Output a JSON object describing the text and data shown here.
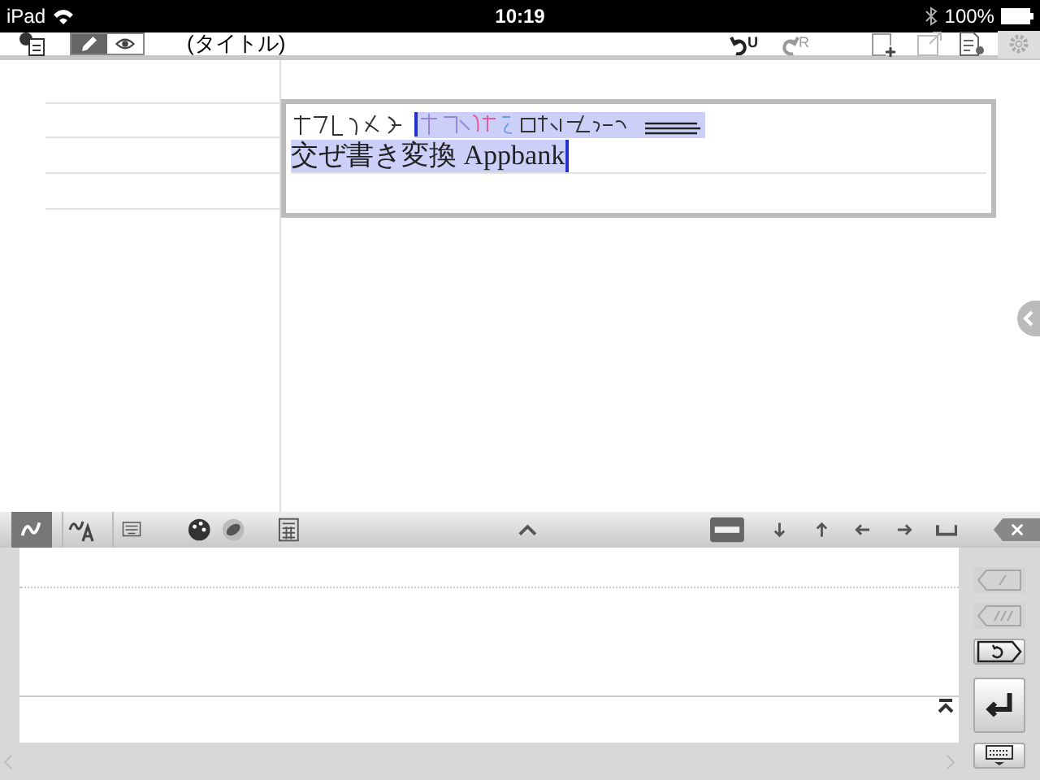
{
  "status_bar": {
    "device": "iPad",
    "time": "10:19",
    "battery": "100%"
  },
  "toolbar": {
    "title": "(タイトル)",
    "modes": [
      {
        "kind": "edit",
        "selected": true
      },
      {
        "kind": "view",
        "selected": false
      }
    ],
    "undo_label": "U",
    "redo_label": "R"
  },
  "document": {
    "converted_text": "交ぜ書き変換 Appbank"
  },
  "input_bar": {
    "modes": [
      {
        "kind": "pen",
        "selected": true
      },
      {
        "kind": "pen-text",
        "selected": false
      },
      {
        "kind": "keyboard",
        "selected": false
      }
    ]
  },
  "side_buttons": [
    {
      "kind": "delete-one",
      "disabled": true
    },
    {
      "kind": "delete-all",
      "disabled": true
    },
    {
      "kind": "undo",
      "disabled": false
    },
    {
      "kind": "enter",
      "disabled": false
    },
    {
      "kind": "keyboard",
      "disabled": false
    }
  ]
}
